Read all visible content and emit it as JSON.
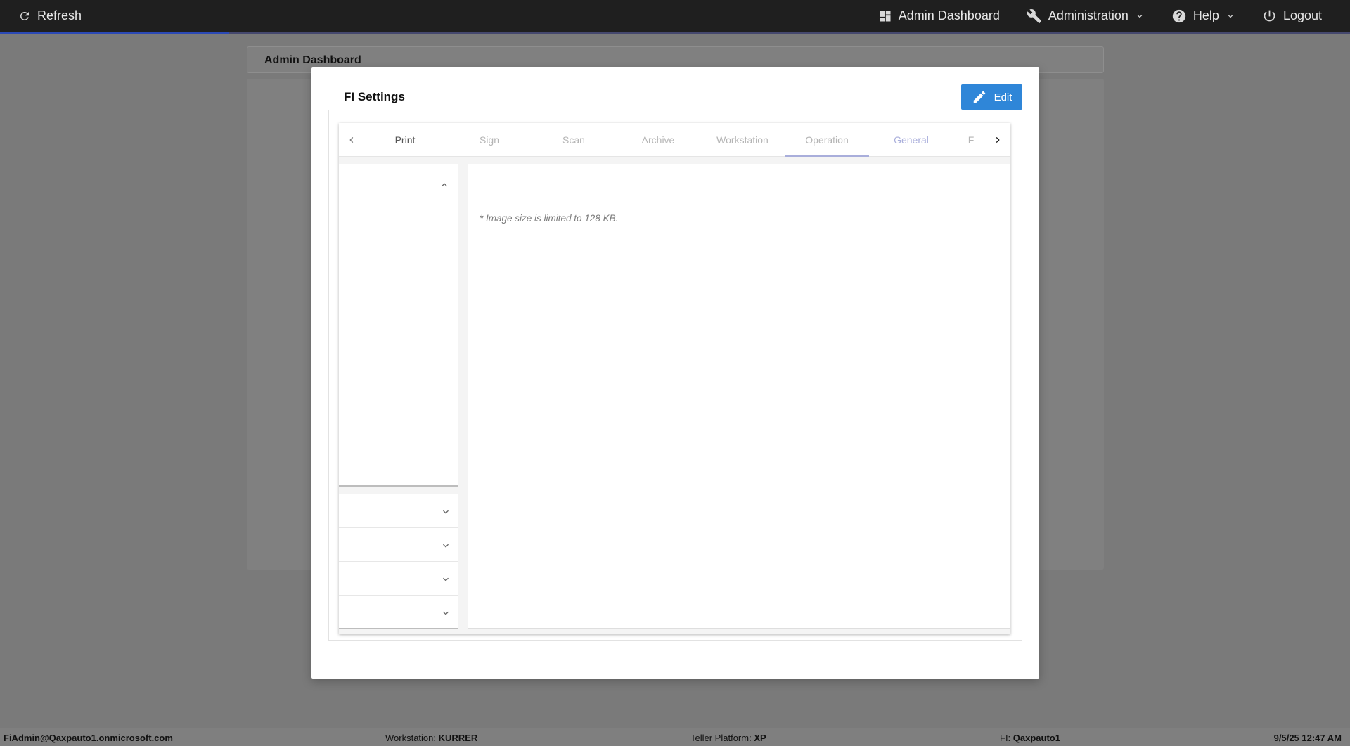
{
  "topbar": {
    "refresh_label": "Refresh",
    "admin_dashboard_label": "Admin Dashboard",
    "administration_label": "Administration",
    "help_label": "Help",
    "logout_label": "Logout",
    "progress_fraction": 0.17
  },
  "page": {
    "title": "Admin Dashboard"
  },
  "modal": {
    "title": "FI Settings",
    "edit_label": "Edit",
    "tabs": [
      {
        "label": "Print"
      },
      {
        "label": "Sign"
      },
      {
        "label": "Scan"
      },
      {
        "label": "Archive"
      },
      {
        "label": "Workstation"
      },
      {
        "label": "Operation"
      },
      {
        "label": "General"
      },
      {
        "label": "F"
      }
    ],
    "active_tab": "Operation",
    "note": "* Image size is limited to 128 KB."
  },
  "statusbar": {
    "user": "FiAdmin@Qaxpauto1.onmicrosoft.com",
    "workstation_label": "Workstation:",
    "workstation_value": "KURRER",
    "platform_label": "Teller Platform:",
    "platform_value": "XP",
    "fi_label": "FI:",
    "fi_value": "Qaxpauto1",
    "datetime": "9/5/25 12:47 AM"
  },
  "colors": {
    "topbar": "#1f1f1f",
    "accent": "#2f86d8",
    "progress": "#2b49b5",
    "tab_indicator": "#a9aedb"
  }
}
